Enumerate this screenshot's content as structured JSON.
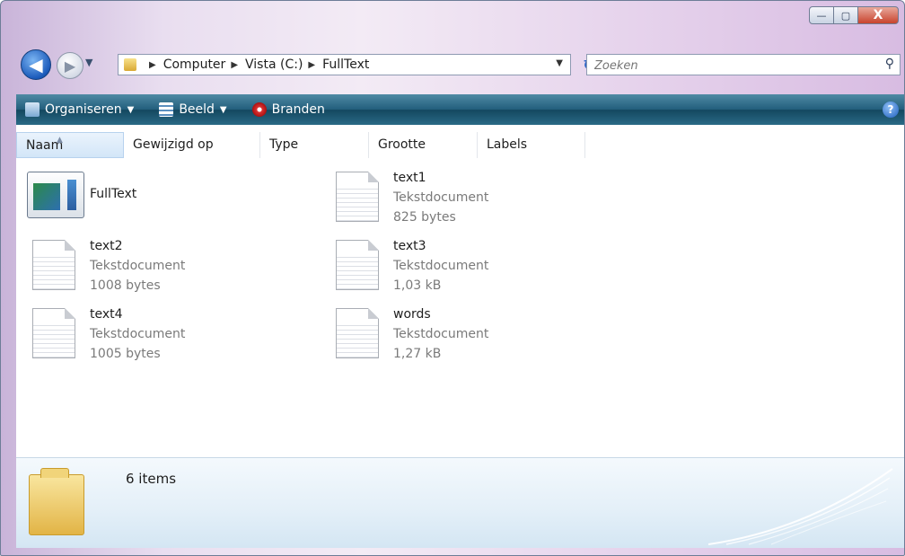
{
  "window": {
    "buttons": {
      "minimize": "—",
      "maximize": "▢",
      "close": "X"
    }
  },
  "nav": {
    "breadcrumb": [
      "Computer",
      "Vista (C:)",
      "FullText"
    ],
    "search_placeholder": "Zoeken"
  },
  "toolbar": {
    "organize": "Organiseren",
    "view": "Beeld",
    "burn": "Branden",
    "help": "?"
  },
  "columns": [
    "Naam",
    "Gewijzigd op",
    "Type",
    "Grootte",
    "Labels"
  ],
  "files": [
    {
      "name": "FullText",
      "type": "",
      "size": "",
      "icon": "application-icon"
    },
    {
      "name": "text1",
      "type": "Tekstdocument",
      "size": "825 bytes",
      "icon": "text-document-icon"
    },
    {
      "name": "text2",
      "type": "Tekstdocument",
      "size": "1008 bytes",
      "icon": "text-document-icon"
    },
    {
      "name": "text3",
      "type": "Tekstdocument",
      "size": "1,03 kB",
      "icon": "text-document-icon"
    },
    {
      "name": "text4",
      "type": "Tekstdocument",
      "size": "1005 bytes",
      "icon": "text-document-icon"
    },
    {
      "name": "words",
      "type": "Tekstdocument",
      "size": "1,27 kB",
      "icon": "text-document-icon"
    }
  ],
  "details": {
    "item_count": "6 items"
  },
  "colors": {
    "toolbar": "#225e7c",
    "title_gradient": "#e9def0"
  }
}
